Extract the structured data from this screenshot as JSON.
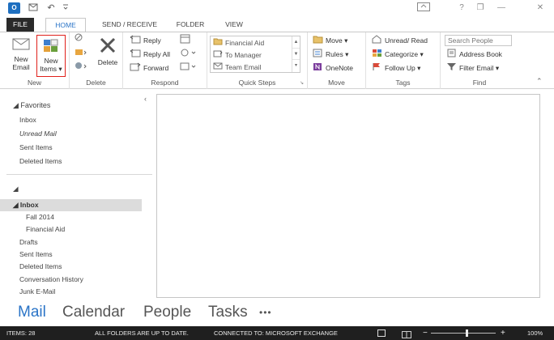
{
  "titlebar": {
    "app_icon": "outlook-logo-icon",
    "app_icon_text": "O",
    "quick_access": [
      "send-receive-icon",
      "undo-icon",
      "customize-icon"
    ],
    "controls": [
      "ribbon-display-icon",
      "help-icon",
      "restore-icon",
      "minimize-icon",
      "close-icon"
    ],
    "help_label": "?",
    "undo_label": "↶",
    "minimize_label": "—",
    "close_label": "✕",
    "restore_label": "❐"
  },
  "tabs": [
    {
      "label": "FILE"
    },
    {
      "label": "HOME"
    },
    {
      "label": "SEND / RECEIVE"
    },
    {
      "label": "FOLDER"
    },
    {
      "label": "VIEW"
    }
  ],
  "ribbon": {
    "new": {
      "label": "New",
      "new_email_line1": "New",
      "new_email_line2": "Email",
      "new_items_line1": "New",
      "new_items_line2": "Items ▾"
    },
    "delete": {
      "label": "Delete",
      "delete_button": "Delete"
    },
    "respond": {
      "label": "Respond",
      "reply": "Reply",
      "reply_all": "Reply All",
      "forward": "Forward"
    },
    "quick_steps": {
      "label": "Quick Steps",
      "items": [
        "Financial Aid",
        "To Manager",
        "Team Email"
      ]
    },
    "move": {
      "label": "Move",
      "move": "Move ▾",
      "rules": "Rules ▾",
      "onenote": "OneNote"
    },
    "tags": {
      "label": "Tags",
      "unread_read": "Unread/ Read",
      "categorize": "Categorize ▾",
      "follow_up": "Follow Up ▾"
    },
    "find": {
      "label": "Find",
      "search_placeholder": "Search People",
      "address_book": "Address Book",
      "filter_email": "Filter Email ▾"
    },
    "collapse_label": "⌃"
  },
  "folder_pane": {
    "collapse_label": "‹",
    "favorites_label": "◢ Favorites",
    "favorites": [
      "Inbox",
      "Unread Mail",
      "Sent Items",
      "Deleted Items"
    ],
    "account_toggle": "◢",
    "inbox_label": "◢ Inbox",
    "inbox_children": [
      "Fall 2014",
      "Financial Aid"
    ],
    "folders": [
      "Drafts",
      "Sent Items",
      "Deleted Items",
      "Conversation History",
      "Junk E-Mail"
    ]
  },
  "nav": {
    "items": [
      "Mail",
      "Calendar",
      "People",
      "Tasks"
    ],
    "more": "•••"
  },
  "status": {
    "items_count": "ITEMS: 28",
    "sync": "ALL FOLDERS ARE UP TO DATE.",
    "connection": "CONNECTED TO: MICROSOFT EXCHANGE",
    "zoom": "100%",
    "zoom_minus": "−",
    "zoom_plus": "+",
    "zoom_level": 0.55
  }
}
